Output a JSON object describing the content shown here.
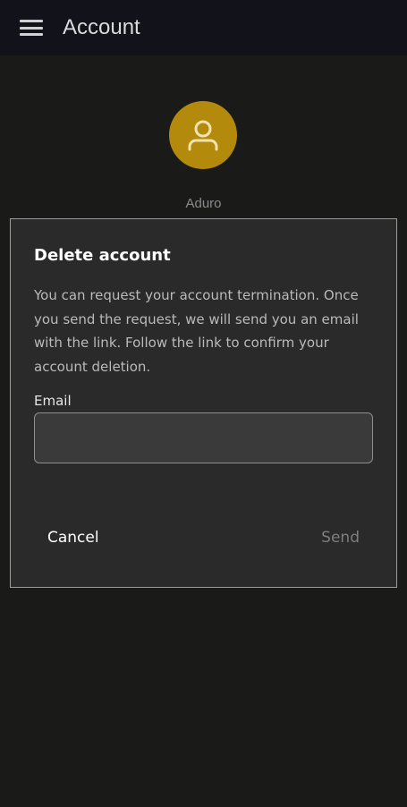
{
  "app_bar": {
    "title": "Account",
    "menu_icon": "hamburger-menu-icon"
  },
  "profile": {
    "avatar_icon": "person-icon",
    "avatar_color": "#b48a0c",
    "name": "Aduro"
  },
  "dialog": {
    "title": "Delete account",
    "message": "You can request your account termination. Once you send the request, we will send you an email with the link. Follow the link to confirm your account deletion.",
    "email_label": "Email",
    "email_value": "",
    "cancel_label": "Cancel",
    "send_label": "Send"
  }
}
